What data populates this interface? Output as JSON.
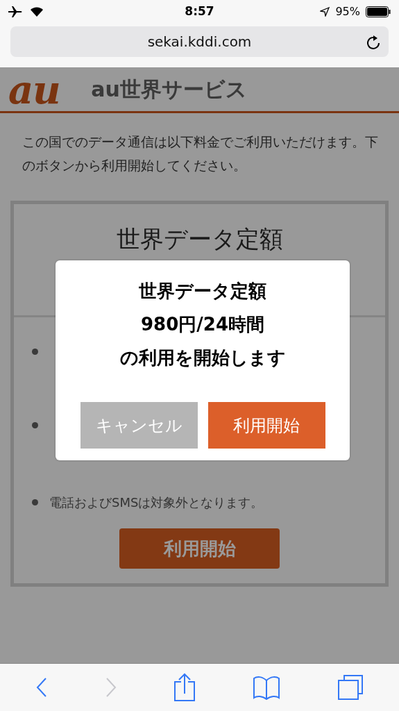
{
  "status_bar": {
    "time": "8:57",
    "battery": "95%"
  },
  "address_bar": {
    "url": "sekai.kddi.com"
  },
  "header": {
    "logo": "au",
    "title": "au世界サービス"
  },
  "intro": "この国でのデータ通信は以下料金でご利用いただけます。下のボタンから利用開始してください。",
  "plan_card": {
    "title": "世界データ定額",
    "bullets": [
      {
        "kind": "covered"
      },
      {
        "kind": "covered"
      },
      {
        "kind": "text",
        "text": "電話およびSMSは対象外となります。"
      }
    ],
    "button": "利用開始"
  },
  "dialog": {
    "lines": [
      "世界データ定額",
      "980円/24時間",
      "の利用を開始します"
    ],
    "buttons": [
      {
        "label": "キャンセル",
        "kind": "cancel"
      },
      {
        "label": "利用開始",
        "kind": "primary"
      }
    ]
  },
  "toolbar": [
    {
      "kind": "back",
      "disabled": false
    },
    {
      "kind": "forward",
      "disabled": true
    },
    {
      "kind": "share",
      "disabled": false
    },
    {
      "kind": "bookmarks",
      "disabled": false
    },
    {
      "kind": "tabs",
      "disabled": false
    }
  ]
}
